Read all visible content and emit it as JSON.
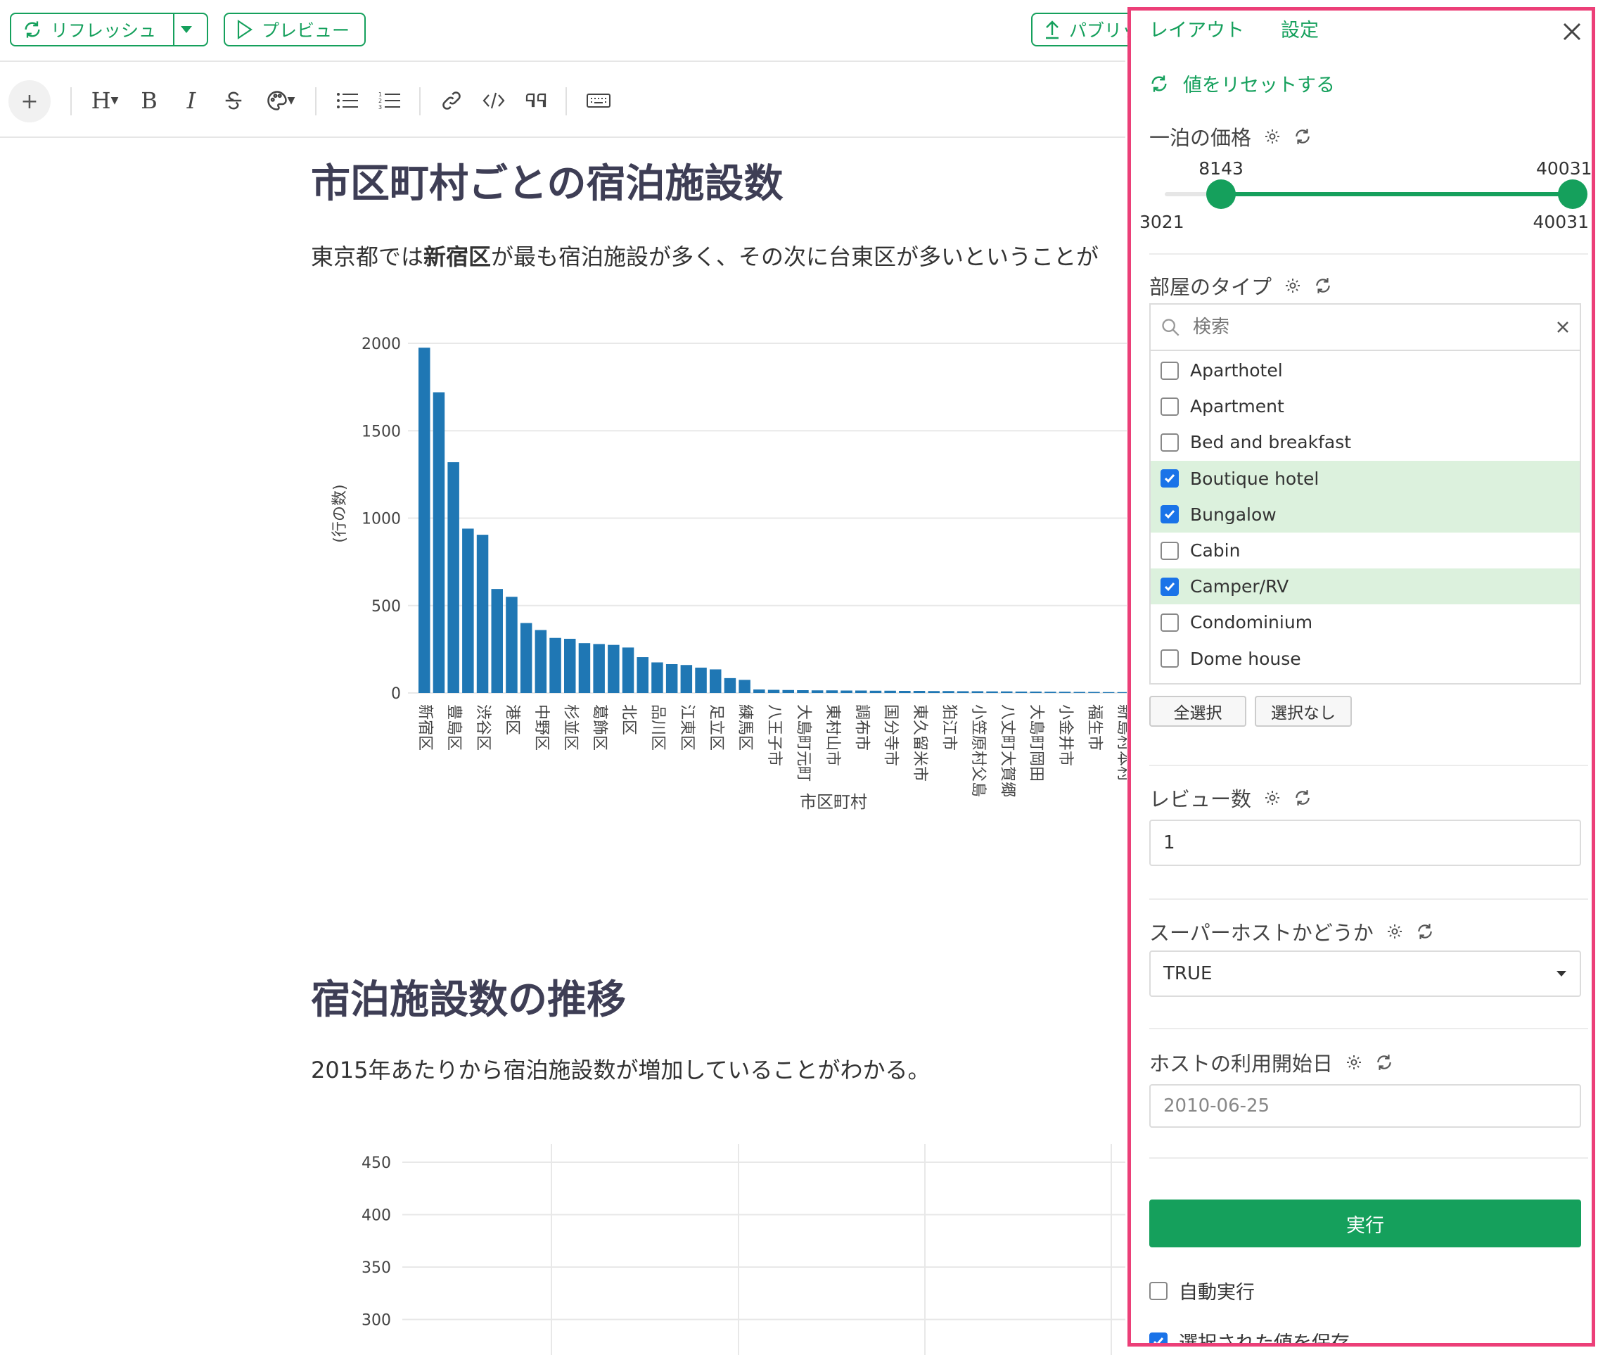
{
  "toolbar": {
    "refresh_label": "リフレッシュ",
    "preview_label": "プレビュー",
    "publish_label": "パブリッ"
  },
  "format_bar": {
    "heading_label": "H",
    "bold_label": "B",
    "italic_label": "I"
  },
  "document": {
    "section1": {
      "title": "市区町村ごとの宿泊施設数",
      "para_prefix": "東京都では",
      "para_bold": "新宿区",
      "para_suffix": "が最も宿泊施設が多く、その次に台東区が多いということが"
    },
    "section2": {
      "title": "宿泊施設数の推移",
      "para": "2015年あたりから宿泊施設数が増加していることがわかる。"
    }
  },
  "chart_data": [
    {
      "type": "bar",
      "title": "",
      "xlabel": "市区町村",
      "ylabel": "(行の数)",
      "ylim": [
        0,
        2000
      ],
      "yticks": [
        0,
        500,
        1000,
        1500,
        2000
      ],
      "x_tick_labels": [
        "新宿区",
        "豊島区",
        "渋谷区",
        "港区",
        "中野区",
        "杉並区",
        "葛飾区",
        "北区",
        "品川区",
        "江東区",
        "足立区",
        "練馬区",
        "八王子市",
        "大島町元町",
        "東村山市",
        "調布市",
        "国分寺市",
        "東久留米市",
        "狛江市",
        "小笠原村父島",
        "八丈町大賀郷",
        "大島町岡田",
        "小金井市",
        "福生市",
        "新島村本村"
      ],
      "values": [
        1975,
        1720,
        1320,
        940,
        905,
        595,
        550,
        400,
        360,
        315,
        310,
        285,
        280,
        275,
        260,
        205,
        175,
        165,
        160,
        145,
        135,
        85,
        75,
        20,
        18,
        17,
        16,
        15,
        15,
        14,
        14,
        13,
        13,
        12,
        12,
        11,
        11,
        10,
        10,
        9,
        9,
        8,
        8,
        7,
        7,
        6,
        6,
        5,
        5,
        4,
        4,
        3,
        3,
        2,
        2,
        2,
        1,
        1,
        1
      ],
      "grid": true,
      "color": "#1f77b4"
    },
    {
      "type": "line",
      "title": "",
      "xlabel": "",
      "ylabel": "",
      "yticks_visible": [
        300,
        350,
        400,
        450
      ],
      "grid": true,
      "series": []
    }
  ],
  "panel": {
    "tab_layout": "レイアウト",
    "tab_settings": "設定",
    "reset_label": "値をリセットする",
    "price": {
      "title": "一泊の価格",
      "selected_min": "8143",
      "selected_max": "40031",
      "range_min": "3021",
      "range_max": "40031",
      "min_value": 3021,
      "max_value": 40031,
      "low_value": 8143,
      "high_value": 40031
    },
    "room_type": {
      "title": "部屋のタイプ",
      "search_placeholder": "検索",
      "options": [
        {
          "label": "Aparthotel",
          "checked": false
        },
        {
          "label": "Apartment",
          "checked": false
        },
        {
          "label": "Bed and breakfast",
          "checked": false
        },
        {
          "label": "Boutique hotel",
          "checked": true
        },
        {
          "label": "Bungalow",
          "checked": true
        },
        {
          "label": "Cabin",
          "checked": false
        },
        {
          "label": "Camper/RV",
          "checked": true
        },
        {
          "label": "Condominium",
          "checked": false
        },
        {
          "label": "Dome house",
          "checked": false
        }
      ],
      "select_all": "全選択",
      "select_none": "選択なし"
    },
    "reviews": {
      "title": "レビュー数",
      "value": "1"
    },
    "superhost": {
      "title": "スーパーホストかどうか",
      "value": "TRUE"
    },
    "host_since": {
      "title": "ホストの利用開始日",
      "value": "2010-06-25"
    },
    "run_label": "実行",
    "auto_run_label": "自動実行",
    "auto_run_checked": false,
    "save_values_label": "選択された値を保存",
    "save_values_checked": true
  },
  "colors": {
    "accent": "#15a05c",
    "panel_border": "#ec3f78",
    "bar": "#1f77b4",
    "selected_row": "#dcf1dd",
    "checkbox_on": "#1a73e8"
  }
}
